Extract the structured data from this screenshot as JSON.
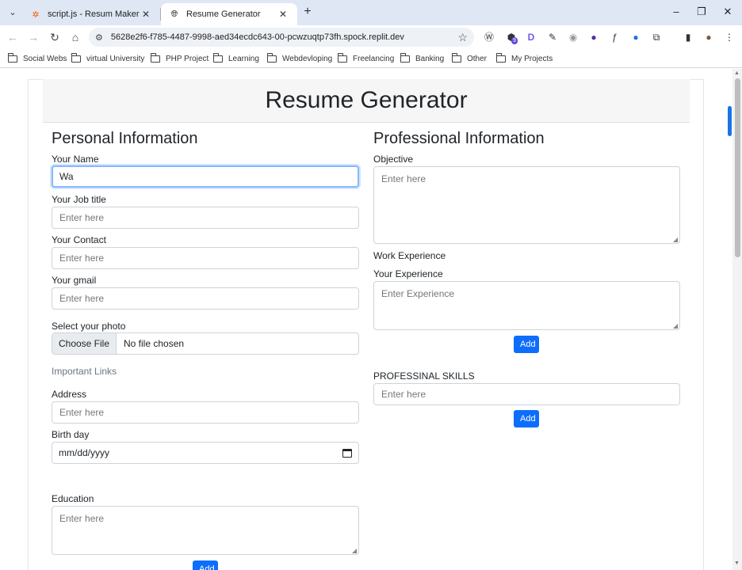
{
  "browser": {
    "tabs": [
      {
        "title": "script.js - Resum Maker - Replit",
        "active": false
      },
      {
        "title": "Resume Generator",
        "active": true
      }
    ],
    "url": "5628e2f6-f785-4487-9998-aed34ecdc643-00-pcwzuqtp73fh.spock.replit.dev",
    "bookmarks": [
      "Social Webs",
      "virtual University",
      "PHP Project",
      "Learning",
      "Webdevloping",
      "Freelancing",
      "Banking",
      "Other",
      "My Projects"
    ],
    "window_controls": {
      "minimize": "–",
      "restore": "❐",
      "close": "✕"
    },
    "new_tab": "+",
    "extension_badge": "9"
  },
  "page": {
    "title": "Resume Generator",
    "personal": {
      "heading": "Personal Information",
      "name_label": "Your Name",
      "name_value": "Wa",
      "job_label": "Your Job title",
      "job_placeholder": "Enter here",
      "contact_label": "Your Contact",
      "contact_placeholder": "Enter here",
      "gmail_label": "Your gmail",
      "gmail_placeholder": "Enter here",
      "photo_label": "Select your photo",
      "photo_button": "Choose File",
      "photo_status": "No file chosen",
      "links_label": "Important Links",
      "address_label": "Address",
      "address_placeholder": "Enter here",
      "birthday_label": "Birth day",
      "birthday_placeholder": "mm/dd/yyyy",
      "education_label": "Education",
      "education_placeholder": "Enter here",
      "education_add": "Add"
    },
    "professional": {
      "heading": "Professional Information",
      "objective_label": "Objective",
      "objective_placeholder": "Enter here",
      "work_label": "Work Experience",
      "experience_label": "Your Experience",
      "experience_placeholder": "Enter Experience",
      "experience_add": "Add",
      "skills_label": "PROFESSINAL SKILLS",
      "skills_placeholder": "Enter here",
      "skills_add": "Add"
    }
  },
  "colors": {
    "accent": "#0d6efd",
    "focus": "#86b7fe",
    "tabstrip": "#dfe7f5"
  }
}
